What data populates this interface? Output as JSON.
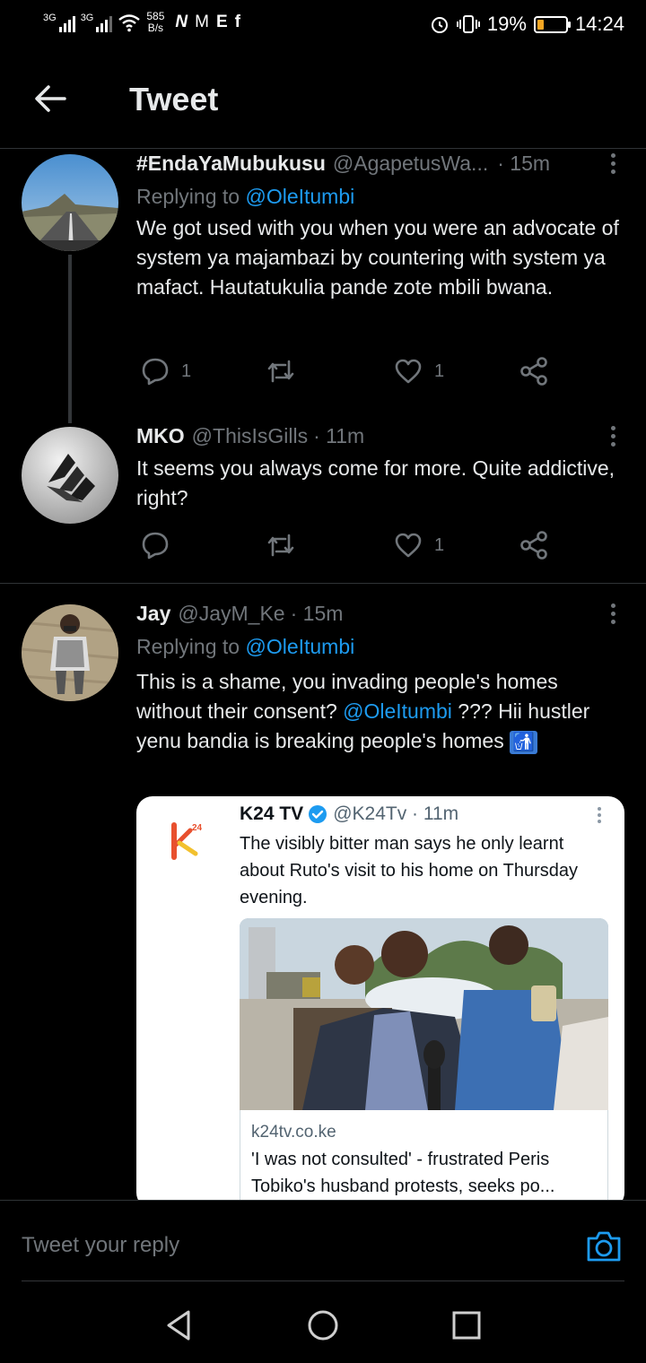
{
  "status_bar": {
    "network1": "3G",
    "network2": "3G",
    "speed_value": "585",
    "speed_unit": "B/s",
    "app_icons": [
      "N",
      "M",
      "E",
      "f"
    ],
    "battery_percent": "19%",
    "battery_level": 0.19,
    "battery_color": "#f5a623",
    "time": "14:24"
  },
  "header": {
    "back_icon": "back-arrow-icon",
    "title": "Tweet"
  },
  "tweets": [
    {
      "name": "#EndaYaMubukusu",
      "handle": "@AgapetusWa...",
      "time": "· 15m",
      "replying_prefix": "Replying to ",
      "replying_to": "@OleItumbi",
      "text": "We got used with you when you were an advocate of system ya majambazi by countering with system ya  mafact. Hautatukulia pande zote mbili bwana.",
      "reply_count": "1",
      "like_count": "1"
    },
    {
      "name": "MKO",
      "handle": "@ThisIsGills",
      "time": "· 11m",
      "text": "It seems you always come for more. Quite addictive, right?",
      "reply_count": "",
      "like_count": "1"
    },
    {
      "name": "Jay",
      "handle": "@JayM_Ke",
      "time": "· 15m",
      "replying_prefix": "Replying to ",
      "replying_to": "@OleItumbi",
      "text_part1": "This is a shame, you invading people's homes without their consent? ",
      "text_mention": "@OleItumbi",
      "text_part2": " ??? Hii hustler yenu bandia is breaking people's homes ",
      "text_emoji": "🚮"
    }
  ],
  "quoted_card": {
    "name": "K24 TV",
    "handle": "@K24Tv · 11m",
    "text": "The visibly bitter man says he only learnt about Ruto's visit to his home on Thursday evening.",
    "domain": "k24tv.co.ke",
    "headline": "'I was not consulted' - frustrated Peris Tobiko's husband protests, seeks po..."
  },
  "reply_bar": {
    "placeholder": "Tweet your reply",
    "camera_icon": "camera-icon"
  },
  "colors": {
    "accent": "#1d9bf0",
    "muted": "#71767b",
    "background": "#000000",
    "text": "#e7e9ea"
  }
}
